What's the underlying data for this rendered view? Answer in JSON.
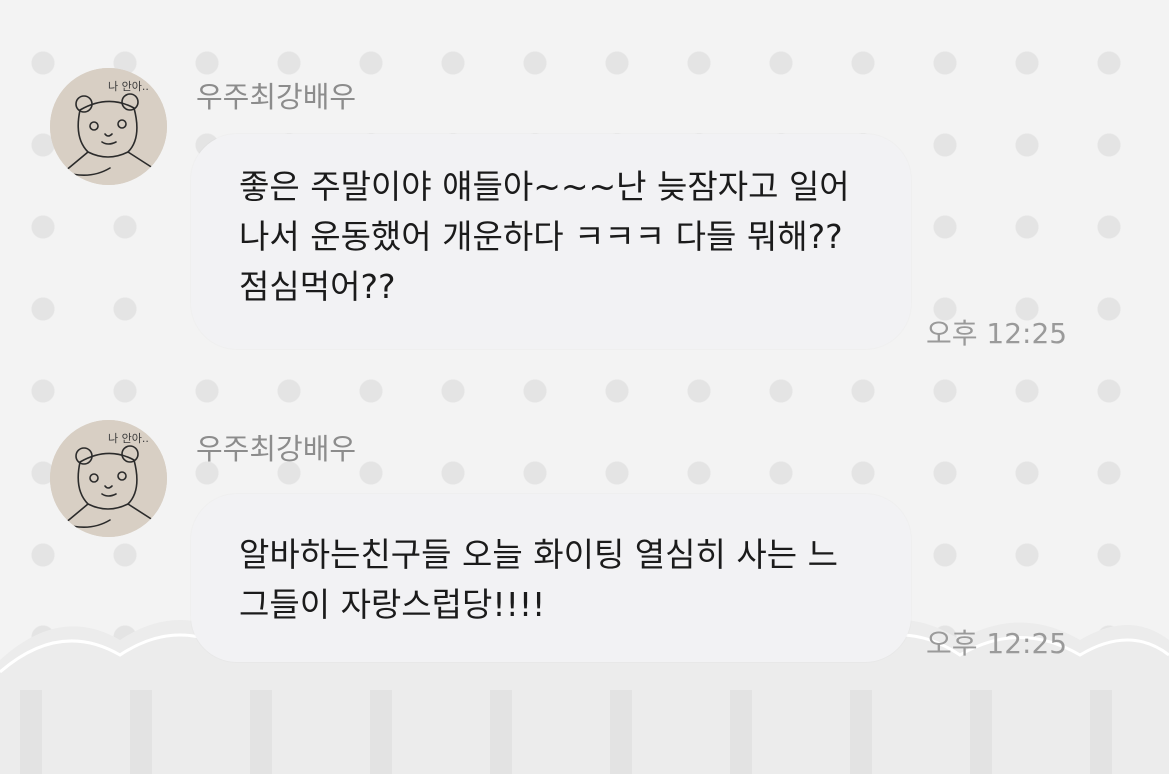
{
  "messages": [
    {
      "sender": "우주최강배우",
      "avatar_caption": "나 안아..",
      "text": "좋은 주말이야 얘들아~~~난 늦잠자고 일어나서 운동했어 개운하다 ㅋㅋㅋ 다들 뭐해?? 점심먹어??",
      "time": "오후 12:25"
    },
    {
      "sender": "우주최강배우",
      "avatar_caption": "나 안아..",
      "text": "알바하는친구들 오늘 화이팅 열심히 사는 느그들이 자랑스럽당!!!!",
      "time": "오후 12:25"
    }
  ],
  "theme": {
    "bubble_color": "#f2f2f4",
    "name_color": "#8c8c8c",
    "time_color": "#9a9a9a",
    "background_color": "#f3f3f3"
  }
}
